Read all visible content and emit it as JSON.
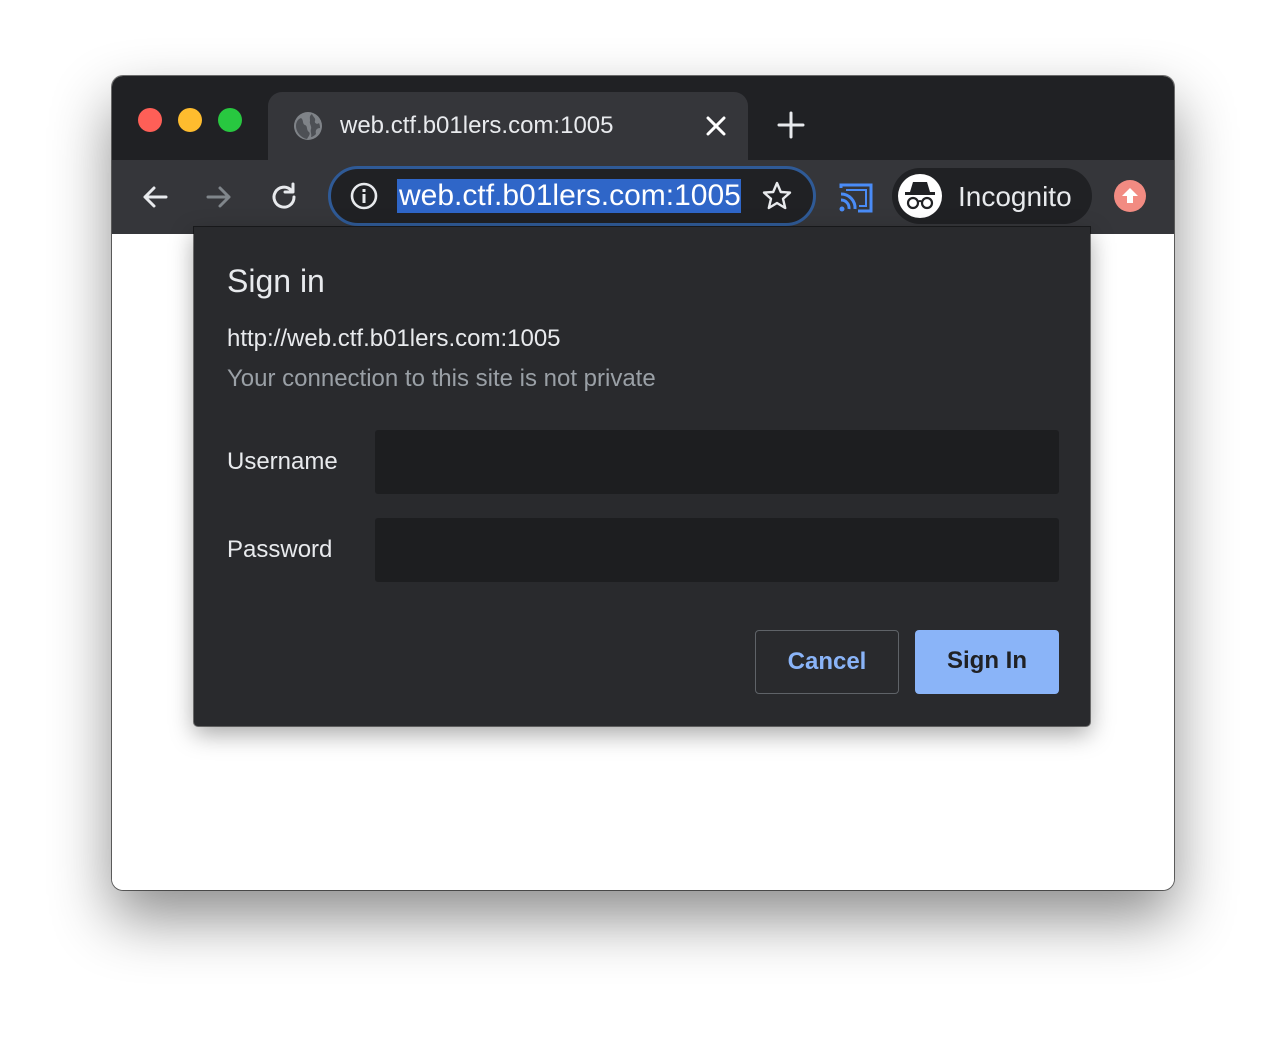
{
  "tab": {
    "title": "web.ctf.b01lers.com:1005",
    "favicon": "globe-icon",
    "close_icon": "close-icon"
  },
  "new_tab_icon": "plus-icon",
  "toolbar": {
    "back_icon": "arrow-left-icon",
    "forward_icon": "arrow-right-icon",
    "reload_icon": "reload-icon",
    "url": "web.ctf.b01lers.com:1005",
    "site_info_icon": "info-icon",
    "bookmark_icon": "star-icon",
    "cast_icon": "cast-icon",
    "profile_label": "Incognito",
    "profile_icon": "incognito-icon",
    "update_icon": "arrow-up-icon"
  },
  "dialog": {
    "title": "Sign in",
    "origin": "http://web.ctf.b01lers.com:1005",
    "warning": "Your connection to this site is not private",
    "username_label": "Username",
    "username_value": "",
    "password_label": "Password",
    "password_value": "",
    "cancel_label": "Cancel",
    "signin_label": "Sign In"
  },
  "colors": {
    "tabstrip": "#202124",
    "toolbar": "#35363a",
    "dialog_bg": "#292a2d",
    "accent": "#8ab4f8",
    "url_highlight": "#2f66c8",
    "close_red": "#fe5f57",
    "minimize_yellow": "#febc2e",
    "zoom_green": "#28c840"
  }
}
